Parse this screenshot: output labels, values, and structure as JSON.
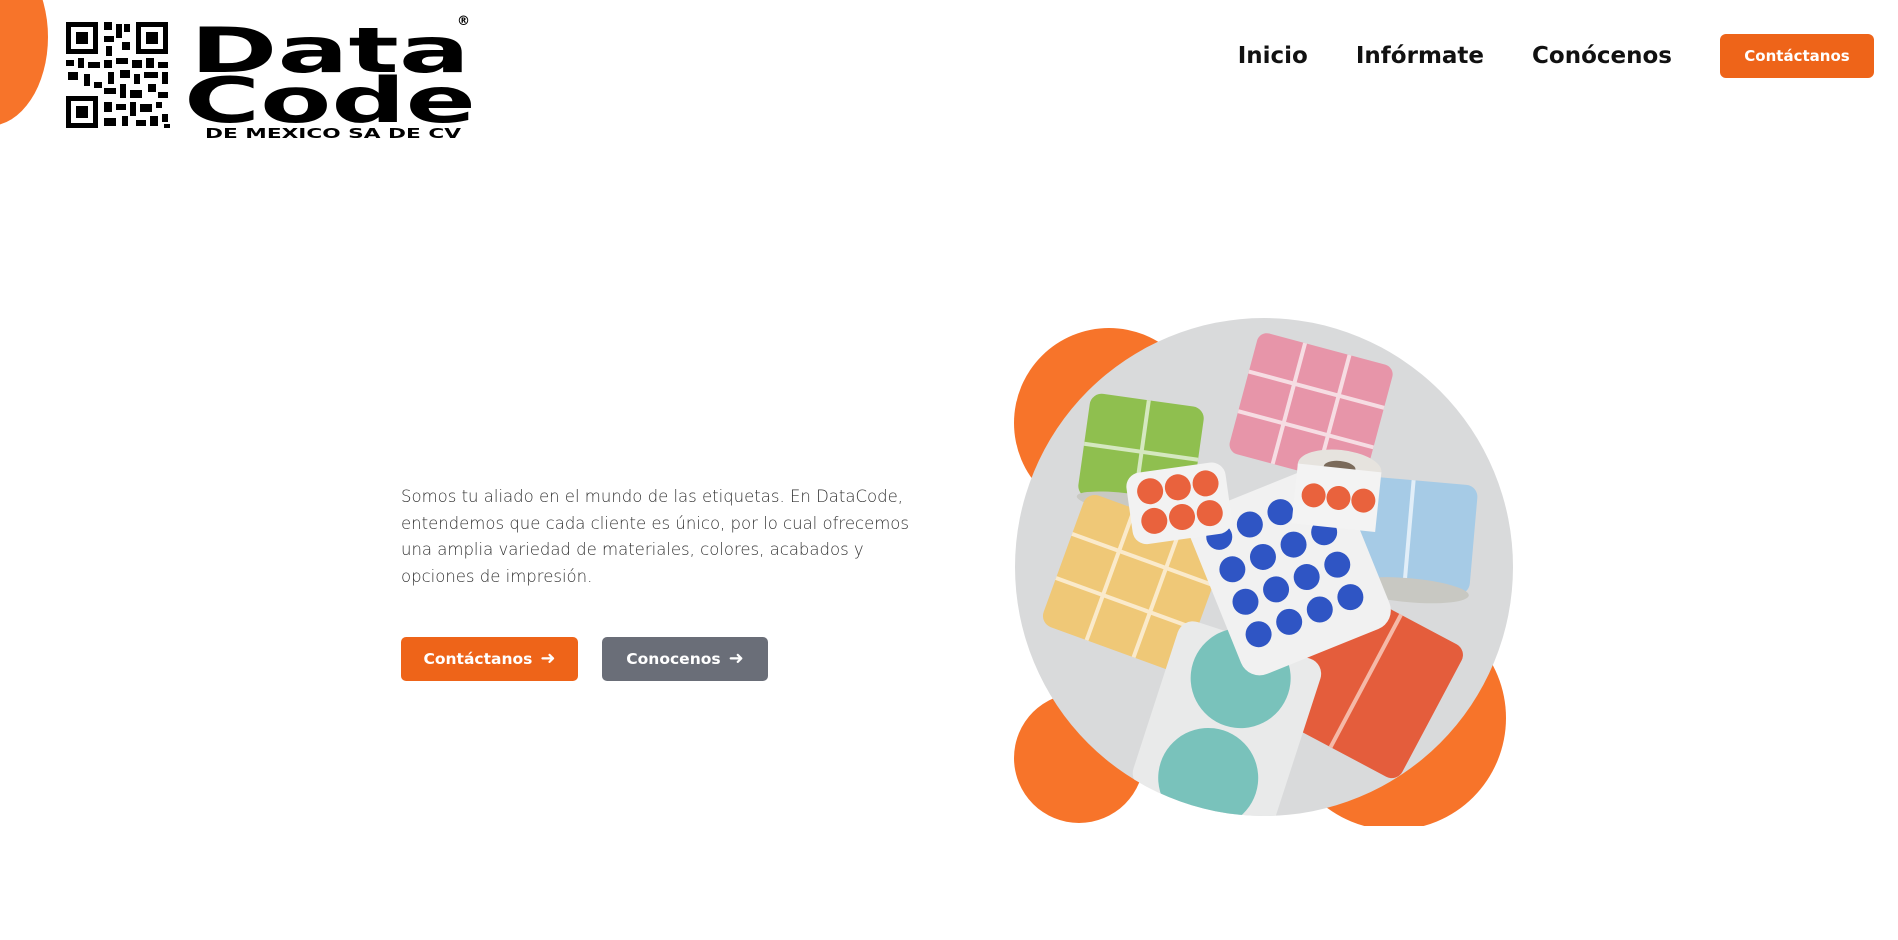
{
  "brand": {
    "line1": "Data",
    "line2": "Code",
    "tagline": "DE MEXICO SA DE CV",
    "registered": "®",
    "accent_color": "#ee6419",
    "secondary_color": "#6a6e78"
  },
  "nav": {
    "items": [
      {
        "label": "Inicio"
      },
      {
        "label": "Infórmate"
      },
      {
        "label": "Conócenos"
      }
    ],
    "cta_label": "Contáctanos"
  },
  "hero": {
    "description": "Somos tu aliado en el mundo de las etiquetas. En DataCode, entendemos que cada cliente es único, por lo cual ofrecemos una amplia variedad de materiales, colores, acabados y opciones de impresión.",
    "primary_button": "Contáctanos",
    "secondary_button": "Conocenos",
    "button_icon": "arrow-right-icon",
    "image": "label-rolls-photo"
  }
}
